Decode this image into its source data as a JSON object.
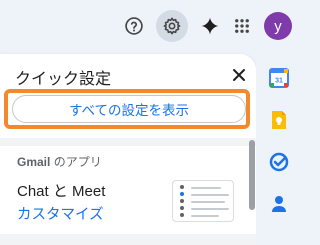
{
  "topbar": {
    "avatar_letter": "y",
    "icons": [
      "help-icon",
      "gear-icon",
      "gemini-star-icon",
      "apps-grid-icon"
    ]
  },
  "quick_settings": {
    "title": "クイック設定",
    "all_settings_button": "すべての設定を表示",
    "section_heading_brand": "Gmail",
    "section_heading_rest": " のアプリ",
    "chat_meet_label": "Chat と Meet",
    "customize_link": "カスタマイズ"
  },
  "side_panel": {
    "apps": [
      "calendar-icon",
      "keep-icon",
      "tasks-icon",
      "contacts-icon"
    ],
    "calendar_day": "31"
  },
  "colors": {
    "highlight": "#f28a2d",
    "link": "#1a73e8",
    "avatar": "#7e3ba9"
  }
}
